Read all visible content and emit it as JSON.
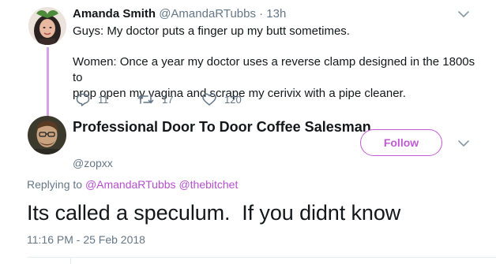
{
  "tweet": {
    "display_name": "Amanda Smith",
    "handle_time": "@AmandaRTubbs · 13h",
    "line1": "Guys: My doctor puts a finger up my butt sometimes.",
    "line2": "Women: Once a year my doctor uses a reverse clamp designed in the 1800s to",
    "line3": "prop open my vagina and scrape my cerivix with a pipe cleaner.",
    "reply_count": "11",
    "retweet_count": "17",
    "like_count": "120"
  },
  "reply": {
    "display_name": "Professional Door To Door Coffee Salesman",
    "handle": "@zopxx",
    "follow_label": "Follow",
    "replying_prefix": "Replying to",
    "mention1": "@AmandaRTubbs",
    "mention2": "@thebitchet",
    "text": "Its called a speculum.  If you didnt know",
    "timestamp": "11:16 PM - 25 Feb 2018"
  },
  "colors": {
    "accent": "#c05bd3",
    "thread_line": "#d9a1e6",
    "secondary_text": "#657786"
  },
  "icons": [
    "reply-icon",
    "retweet-icon",
    "like-icon",
    "chevron-down-icon"
  ]
}
